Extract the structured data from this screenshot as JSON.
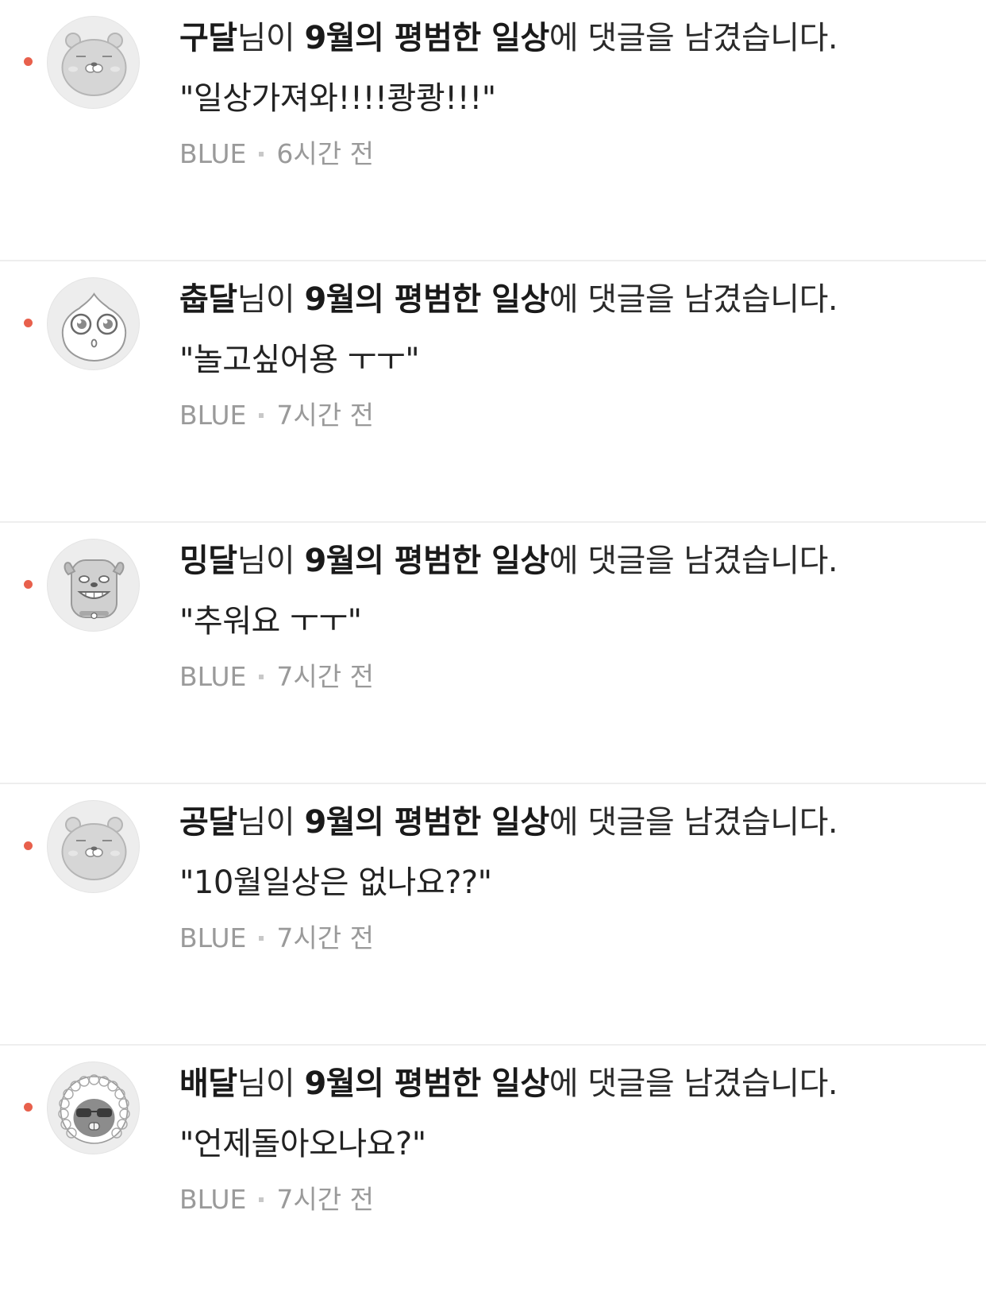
{
  "notification_suffix": "에 댓글을 남겼습니다.",
  "post_title": "9월의 평범한 일상",
  "name_suffix": "님이",
  "colors": {
    "unread_dot": "#e8604c",
    "meta_text": "#9a9a9a",
    "divider": "#eeeeee"
  },
  "notifications": [
    {
      "user": "구달",
      "post": "9월의 평범한 일상",
      "comment": "\"일상가져와!!!!쾅쾅!!!\"",
      "board": "BLUE",
      "time": "6시간 전",
      "avatar_icon": "bear-face-icon"
    },
    {
      "user": "춥달",
      "post": "9월의 평범한 일상",
      "comment": "\"놀고싶어용 ㅜㅜ\"",
      "board": "BLUE",
      "time": "7시간 전",
      "avatar_icon": "peach-face-icon"
    },
    {
      "user": "밍달",
      "post": "9월의 평범한 일상",
      "comment": "\"추워요 ㅜㅜ\"",
      "board": "BLUE",
      "time": "7시간 전",
      "avatar_icon": "dog-face-icon"
    },
    {
      "user": "공달",
      "post": "9월의 평범한 일상",
      "comment": "\"10월일상은 없나요??\"",
      "board": "BLUE",
      "time": "7시간 전",
      "avatar_icon": "bear-face-icon"
    },
    {
      "user": "배달",
      "post": "9월의 평범한 일상",
      "comment": "\"언제돌아오나요?\"",
      "board": "BLUE",
      "time": "7시간 전",
      "avatar_icon": "curly-hair-face-icon"
    }
  ]
}
